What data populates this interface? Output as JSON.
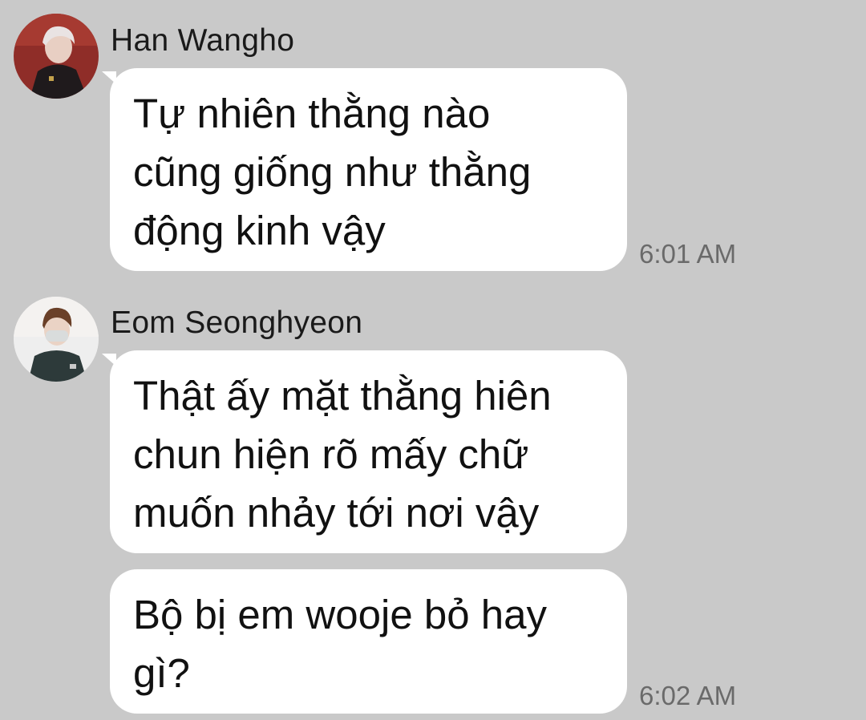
{
  "messages": [
    {
      "sender": "Han Wangho",
      "avatar_icon": "avatar-han-wangho",
      "bubbles": [
        {
          "lines": [
            "Tự nhiên thằng nào",
            "cũng giống như thằng",
            "động kinh vậy"
          ],
          "time": "6:01 AM"
        }
      ]
    },
    {
      "sender": "Eom Seonghyeon",
      "avatar_icon": "avatar-eom-seonghyeon",
      "bubbles": [
        {
          "lines": [
            "Thật ấy mặt thằng hiên",
            "chun hiện rõ mấy chữ",
            "muốn nhảy tới nơi vậy"
          ],
          "time": ""
        },
        {
          "lines": [
            "Bộ bị em wooje bỏ hay",
            "gì?"
          ],
          "time": "6:02 AM"
        }
      ]
    }
  ],
  "colors": {
    "background": "#c9c9c9",
    "bubble": "#ffffff",
    "text": "#111111",
    "timestamp": "#6a6a6a"
  }
}
